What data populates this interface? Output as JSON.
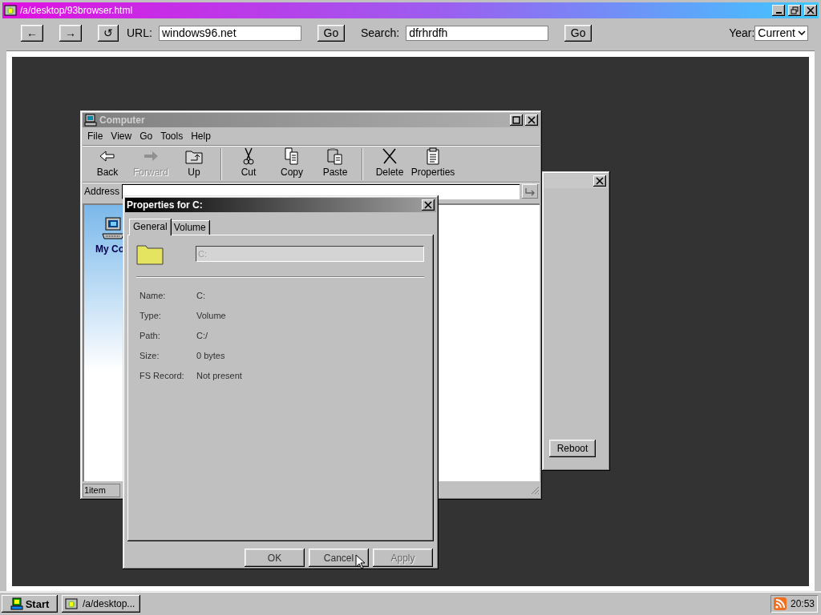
{
  "browser": {
    "title": "/a/desktop/93browser.html",
    "toolbar": {
      "back": "←",
      "forward": "→",
      "reload": "↺",
      "url_label": "URL:",
      "url": "windows96.net",
      "url_go": "Go",
      "search_label": "Search:",
      "search": "dfrhrdfh",
      "search_go": "Go",
      "year_label": "Year:",
      "year": "Current"
    }
  },
  "background_window": {
    "active": false,
    "button": "Reboot"
  },
  "computer_window": {
    "title": "Computer",
    "active": false,
    "menu": [
      "File",
      "View",
      "Go",
      "Tools",
      "Help"
    ],
    "toolbar_groups": [
      [
        {
          "kind": "back",
          "label": "Back",
          "disabled": false
        },
        {
          "kind": "forward",
          "label": "Forward",
          "disabled": true
        },
        {
          "kind": "up",
          "label": "Up",
          "disabled": false
        }
      ],
      [
        {
          "kind": "cut",
          "label": "Cut",
          "disabled": false
        },
        {
          "kind": "copy",
          "label": "Copy",
          "disabled": false
        },
        {
          "kind": "paste",
          "label": "Paste",
          "disabled": false
        }
      ],
      [
        {
          "kind": "delete",
          "label": "Delete",
          "disabled": false
        },
        {
          "kind": "properties",
          "label": "Properties",
          "disabled": false
        }
      ]
    ],
    "address_label": "Address",
    "items": [
      {
        "label": "My Co",
        "selected": false
      }
    ],
    "status": "1item"
  },
  "properties_dialog": {
    "title": "Properties for C:",
    "active": true,
    "tabs": [
      {
        "label": "General",
        "selected": true
      },
      {
        "label": "Volume",
        "selected": false
      }
    ],
    "name_field": "C:",
    "rows": [
      {
        "label": "Name:",
        "value": "C:"
      },
      {
        "label": "Type:",
        "value": "Volume"
      },
      {
        "label": "Path:",
        "value": "C:/"
      },
      {
        "label": "Size:",
        "value": "0 bytes"
      },
      {
        "label": "FS Record:",
        "value": "Not present"
      }
    ],
    "buttons": [
      {
        "label": "OK",
        "disabled": false
      },
      {
        "label": "Cancel",
        "disabled": false
      },
      {
        "label": "Apply",
        "disabled": true
      }
    ]
  },
  "taskbar": {
    "start": "Start",
    "tasks": [
      {
        "label": "/a/desktop...",
        "selected": false
      }
    ],
    "clock": "20:53"
  }
}
